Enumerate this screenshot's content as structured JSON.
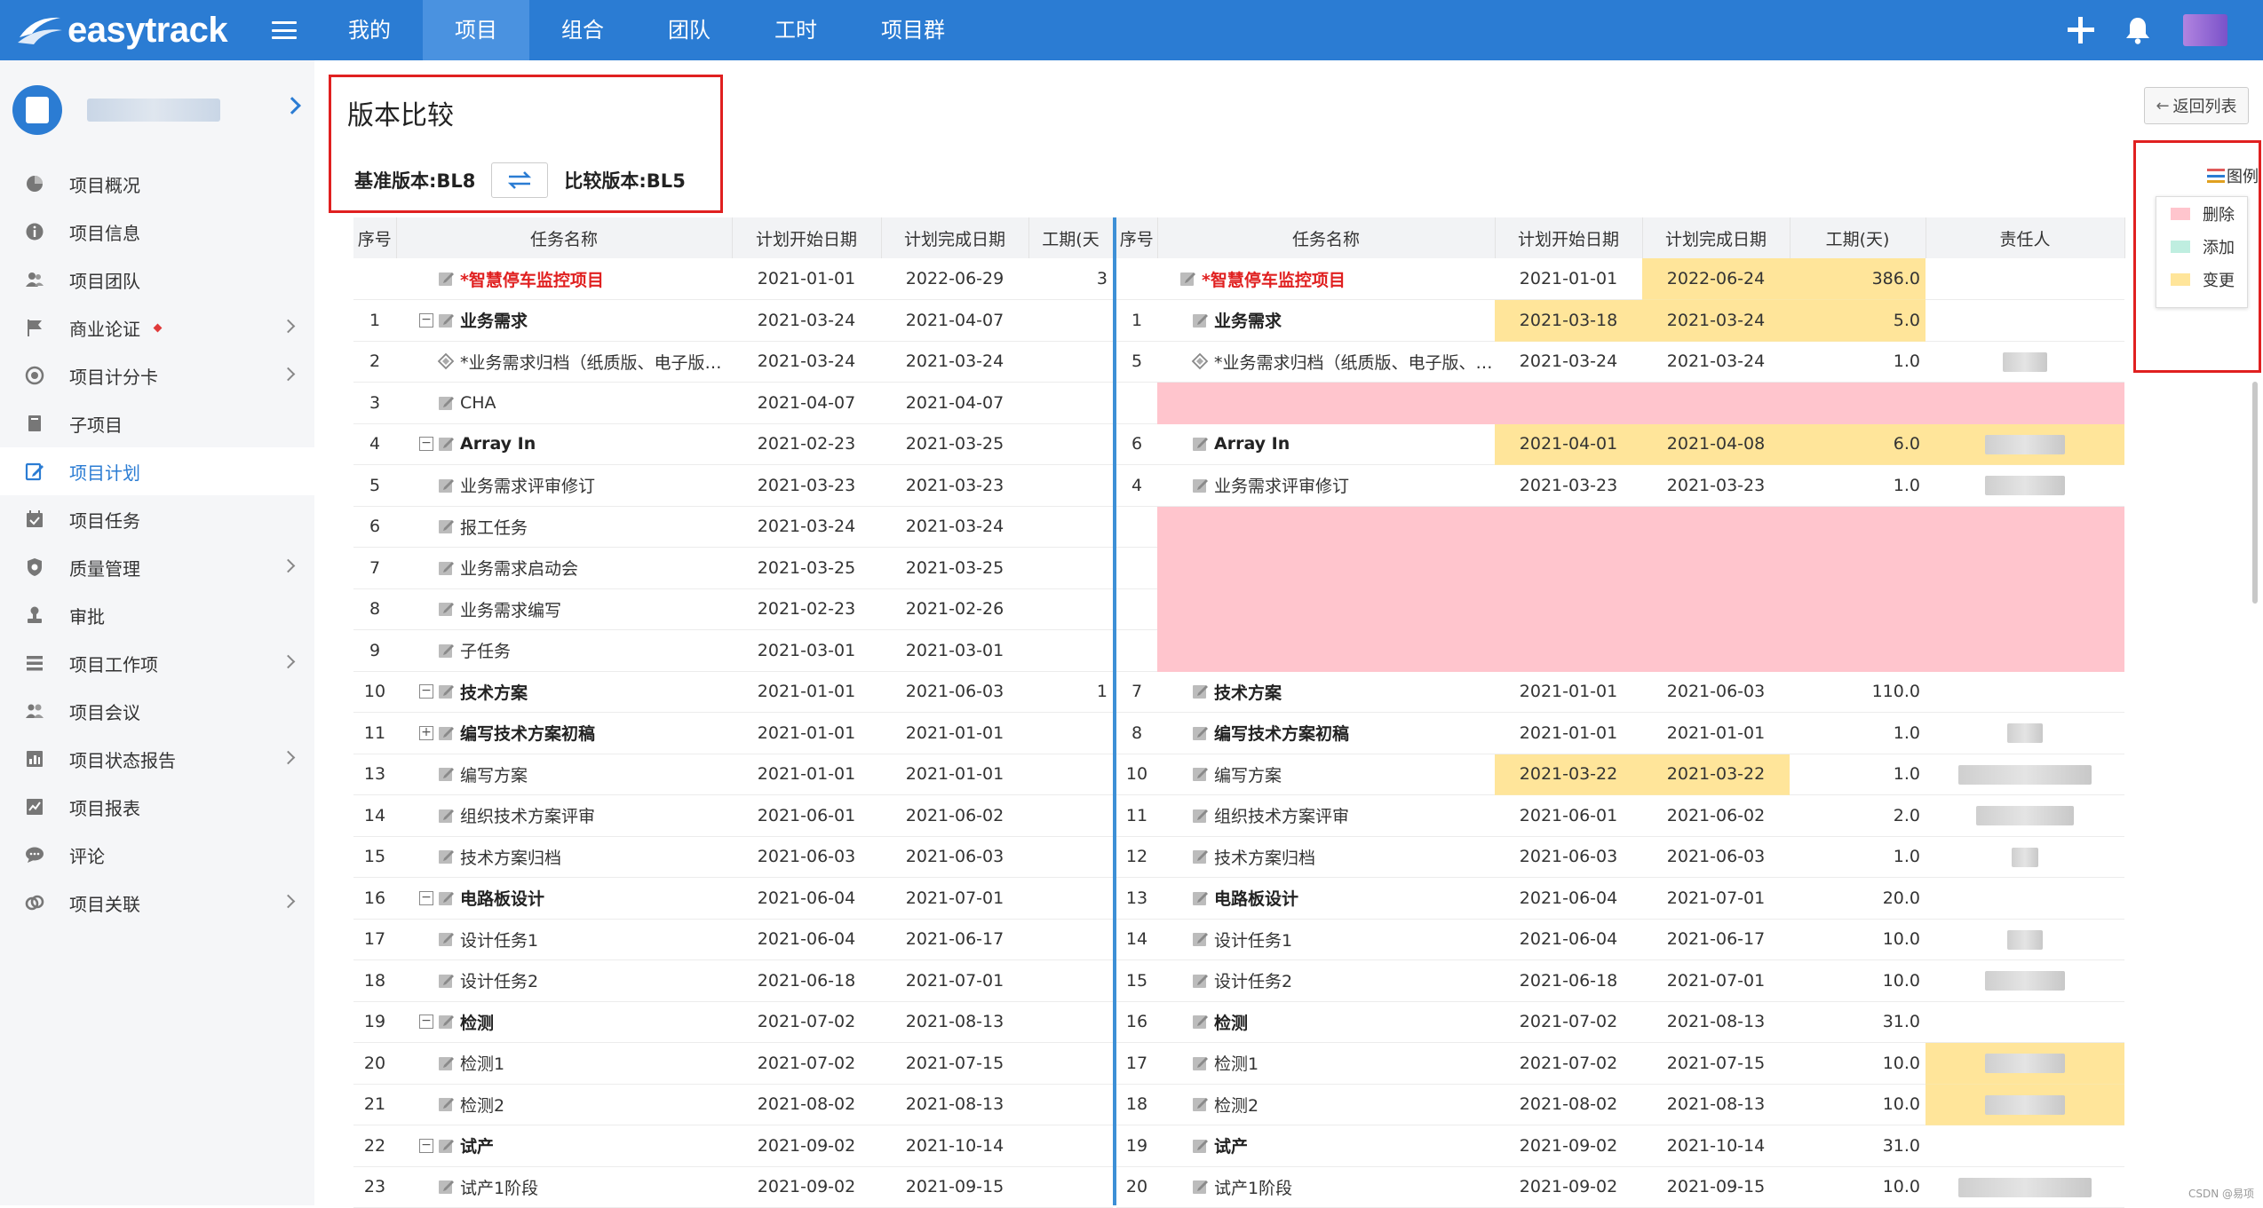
{
  "app": {
    "logo": "easytrack"
  },
  "nav": {
    "items": [
      "我的",
      "项目",
      "组合",
      "团队",
      "工时",
      "项目群"
    ],
    "active_index": 1
  },
  "sidebar": {
    "items": [
      {
        "label": "项目概况",
        "icon": "pie-chart-icon",
        "chevron": false
      },
      {
        "label": "项目信息",
        "icon": "info-icon",
        "chevron": false
      },
      {
        "label": "项目团队",
        "icon": "team-icon",
        "chevron": false
      },
      {
        "label": "商业论证",
        "icon": "flag-icon",
        "chevron": true,
        "dot": true
      },
      {
        "label": "项目计分卡",
        "icon": "target-icon",
        "chevron": true
      },
      {
        "label": "子项目",
        "icon": "book-icon",
        "chevron": false
      },
      {
        "label": "项目计划",
        "icon": "edit-plan-icon",
        "chevron": false,
        "active": true
      },
      {
        "label": "项目任务",
        "icon": "calendar-check-icon",
        "chevron": false
      },
      {
        "label": "质量管理",
        "icon": "shield-icon",
        "chevron": true
      },
      {
        "label": "审批",
        "icon": "stamp-icon",
        "chevron": false
      },
      {
        "label": "项目工作项",
        "icon": "list-icon",
        "chevron": true
      },
      {
        "label": "项目会议",
        "icon": "meeting-icon",
        "chevron": false
      },
      {
        "label": "项目状态报告",
        "icon": "bar-report-icon",
        "chevron": true
      },
      {
        "label": "项目报表",
        "icon": "line-report-icon",
        "chevron": false
      },
      {
        "label": "评论",
        "icon": "comment-icon",
        "chevron": false
      },
      {
        "label": "项目关联",
        "icon": "link-icon",
        "chevron": true
      }
    ]
  },
  "page": {
    "title": "版本比较",
    "base_version": "基准版本:BL8",
    "compare_version": "比较版本:BL5",
    "back_label": "返回列表",
    "legend_label": "图例",
    "legend": [
      {
        "label": "删除",
        "color": "#ffc5cd"
      },
      {
        "label": "添加",
        "color": "#bfeee0"
      },
      {
        "label": "变更",
        "color": "#ffe59a"
      }
    ]
  },
  "left_table": {
    "headers": [
      "序号",
      "任务名称",
      "计划开始日期",
      "计划完成日期",
      "工期(天"
    ],
    "rows": [
      {
        "idx": "",
        "name": "*智慧停车监控项目",
        "start": "2021-01-01",
        "end": "2022-06-29",
        "dur": "3",
        "level": 0,
        "type": "root",
        "exp": ""
      },
      {
        "idx": "1",
        "name": "业务需求",
        "start": "2021-03-24",
        "end": "2021-04-07",
        "dur": "",
        "level": 1,
        "type": "bold",
        "exp": "−"
      },
      {
        "idx": "2",
        "name": "*业务需求归档（纸质版、电子版、…",
        "start": "2021-03-24",
        "end": "2021-03-24",
        "dur": "",
        "level": 2,
        "type": "milestone",
        "exp": ""
      },
      {
        "idx": "3",
        "name": "CHA",
        "start": "2021-04-07",
        "end": "2021-04-07",
        "dur": "",
        "level": 2,
        "type": "task",
        "exp": ""
      },
      {
        "idx": "4",
        "name": "Array In",
        "start": "2021-02-23",
        "end": "2021-03-25",
        "dur": "",
        "level": 1,
        "type": "bold",
        "exp": "−"
      },
      {
        "idx": "5",
        "name": "业务需求评审修订",
        "start": "2021-03-23",
        "end": "2021-03-23",
        "dur": "",
        "level": 2,
        "type": "task",
        "exp": ""
      },
      {
        "idx": "6",
        "name": "报工任务",
        "start": "2021-03-24",
        "end": "2021-03-24",
        "dur": "",
        "level": 2,
        "type": "task",
        "exp": ""
      },
      {
        "idx": "7",
        "name": "业务需求启动会",
        "start": "2021-03-25",
        "end": "2021-03-25",
        "dur": "",
        "level": 2,
        "type": "task",
        "exp": ""
      },
      {
        "idx": "8",
        "name": "业务需求编写",
        "start": "2021-02-23",
        "end": "2021-02-26",
        "dur": "",
        "level": 2,
        "type": "task",
        "exp": ""
      },
      {
        "idx": "9",
        "name": "子任务",
        "start": "2021-03-01",
        "end": "2021-03-01",
        "dur": "",
        "level": 2,
        "type": "task",
        "exp": ""
      },
      {
        "idx": "10",
        "name": "技术方案",
        "start": "2021-01-01",
        "end": "2021-06-03",
        "dur": "1",
        "level": 1,
        "type": "bold",
        "exp": "−"
      },
      {
        "idx": "11",
        "name": "编写技术方案初稿",
        "start": "2021-01-01",
        "end": "2021-01-01",
        "dur": "",
        "level": 2,
        "type": "bold",
        "exp": "+"
      },
      {
        "idx": "13",
        "name": "编写方案",
        "start": "2021-01-01",
        "end": "2021-01-01",
        "dur": "",
        "level": 2,
        "type": "task",
        "exp": ""
      },
      {
        "idx": "14",
        "name": "组织技术方案评审",
        "start": "2021-06-01",
        "end": "2021-06-02",
        "dur": "",
        "level": 2,
        "type": "task",
        "exp": ""
      },
      {
        "idx": "15",
        "name": "技术方案归档",
        "start": "2021-06-03",
        "end": "2021-06-03",
        "dur": "",
        "level": 2,
        "type": "task",
        "exp": ""
      },
      {
        "idx": "16",
        "name": "电路板设计",
        "start": "2021-06-04",
        "end": "2021-07-01",
        "dur": "",
        "level": 1,
        "type": "bold",
        "exp": "−"
      },
      {
        "idx": "17",
        "name": "设计任务1",
        "start": "2021-06-04",
        "end": "2021-06-17",
        "dur": "",
        "level": 2,
        "type": "task",
        "exp": ""
      },
      {
        "idx": "18",
        "name": "设计任务2",
        "start": "2021-06-18",
        "end": "2021-07-01",
        "dur": "",
        "level": 2,
        "type": "task",
        "exp": ""
      },
      {
        "idx": "19",
        "name": "检测",
        "start": "2021-07-02",
        "end": "2021-08-13",
        "dur": "",
        "level": 1,
        "type": "bold",
        "exp": "−"
      },
      {
        "idx": "20",
        "name": "检测1",
        "start": "2021-07-02",
        "end": "2021-07-15",
        "dur": "",
        "level": 2,
        "type": "task",
        "exp": ""
      },
      {
        "idx": "21",
        "name": "检测2",
        "start": "2021-08-02",
        "end": "2021-08-13",
        "dur": "",
        "level": 2,
        "type": "task",
        "exp": ""
      },
      {
        "idx": "22",
        "name": "试产",
        "start": "2021-09-02",
        "end": "2021-10-14",
        "dur": "",
        "level": 1,
        "type": "bold",
        "exp": "−"
      },
      {
        "idx": "23",
        "name": "试产1阶段",
        "start": "2021-09-02",
        "end": "2021-09-15",
        "dur": "",
        "level": 2,
        "type": "task",
        "exp": ""
      }
    ]
  },
  "right_table": {
    "headers": [
      "序号",
      "任务名称",
      "计划开始日期",
      "计划完成日期",
      "工期(天)",
      "责任人"
    ],
    "rows": [
      {
        "idx": "",
        "name": "*智慧停车监控项目",
        "start": "2021-01-01",
        "end": "2022-06-24",
        "dur": "386.0",
        "type": "root",
        "hl": [
          "end",
          "dur"
        ],
        "owner": 0
      },
      {
        "idx": "1",
        "name": "业务需求",
        "start": "2021-03-18",
        "end": "2021-03-24",
        "dur": "5.0",
        "type": "bold",
        "hl": [
          "start",
          "end",
          "dur"
        ],
        "owner": 0
      },
      {
        "idx": "5",
        "name": "*业务需求归档（纸质版、电子版、评…",
        "start": "2021-03-24",
        "end": "2021-03-24",
        "dur": "1.0",
        "type": "milestone",
        "hl": [],
        "owner": 50
      },
      {
        "deleted": true
      },
      {
        "idx": "6",
        "name": "Array In",
        "start": "2021-04-01",
        "end": "2021-04-08",
        "dur": "6.0",
        "type": "bold",
        "hl": [
          "start",
          "end",
          "dur",
          "owner"
        ],
        "owner": 90
      },
      {
        "idx": "4",
        "name": "业务需求评审修订",
        "start": "2021-03-23",
        "end": "2021-03-23",
        "dur": "1.0",
        "type": "task",
        "hl": [],
        "owner": 90
      },
      {
        "deleted": true
      },
      {
        "deleted": true
      },
      {
        "deleted": true
      },
      {
        "deleted": true
      },
      {
        "idx": "7",
        "name": "技术方案",
        "start": "2021-01-01",
        "end": "2021-06-03",
        "dur": "110.0",
        "type": "bold",
        "hl": [],
        "owner": 0
      },
      {
        "idx": "8",
        "name": "编写技术方案初稿",
        "start": "2021-01-01",
        "end": "2021-01-01",
        "dur": "1.0",
        "type": "bold",
        "hl": [],
        "owner": 40
      },
      {
        "idx": "10",
        "name": "编写方案",
        "start": "2021-03-22",
        "end": "2021-03-22",
        "dur": "1.0",
        "type": "task",
        "hl": [
          "start",
          "end"
        ],
        "owner": 150
      },
      {
        "idx": "11",
        "name": "组织技术方案评审",
        "start": "2021-06-01",
        "end": "2021-06-02",
        "dur": "2.0",
        "type": "task",
        "hl": [],
        "owner": 110
      },
      {
        "idx": "12",
        "name": "技术方案归档",
        "start": "2021-06-03",
        "end": "2021-06-03",
        "dur": "1.0",
        "type": "task",
        "hl": [],
        "owner": 30
      },
      {
        "idx": "13",
        "name": "电路板设计",
        "start": "2021-06-04",
        "end": "2021-07-01",
        "dur": "20.0",
        "type": "bold",
        "hl": [],
        "owner": 0
      },
      {
        "idx": "14",
        "name": "设计任务1",
        "start": "2021-06-04",
        "end": "2021-06-17",
        "dur": "10.0",
        "type": "task",
        "hl": [],
        "owner": 40
      },
      {
        "idx": "15",
        "name": "设计任务2",
        "start": "2021-06-18",
        "end": "2021-07-01",
        "dur": "10.0",
        "type": "task",
        "hl": [],
        "owner": 90
      },
      {
        "idx": "16",
        "name": "检测",
        "start": "2021-07-02",
        "end": "2021-08-13",
        "dur": "31.0",
        "type": "bold",
        "hl": [],
        "owner": 0
      },
      {
        "idx": "17",
        "name": "检测1",
        "start": "2021-07-02",
        "end": "2021-07-15",
        "dur": "10.0",
        "type": "task",
        "hl": [
          "owner"
        ],
        "owner": 90
      },
      {
        "idx": "18",
        "name": "检测2",
        "start": "2021-08-02",
        "end": "2021-08-13",
        "dur": "10.0",
        "type": "task",
        "hl": [
          "owner"
        ],
        "owner": 90
      },
      {
        "idx": "19",
        "name": "试产",
        "start": "2021-09-02",
        "end": "2021-10-14",
        "dur": "31.0",
        "type": "bold",
        "hl": [],
        "owner": 0
      },
      {
        "idx": "20",
        "name": "试产1阶段",
        "start": "2021-09-02",
        "end": "2021-09-15",
        "dur": "10.0",
        "type": "task",
        "hl": [],
        "owner": 150
      }
    ]
  },
  "watermark": "CSDN @易项"
}
